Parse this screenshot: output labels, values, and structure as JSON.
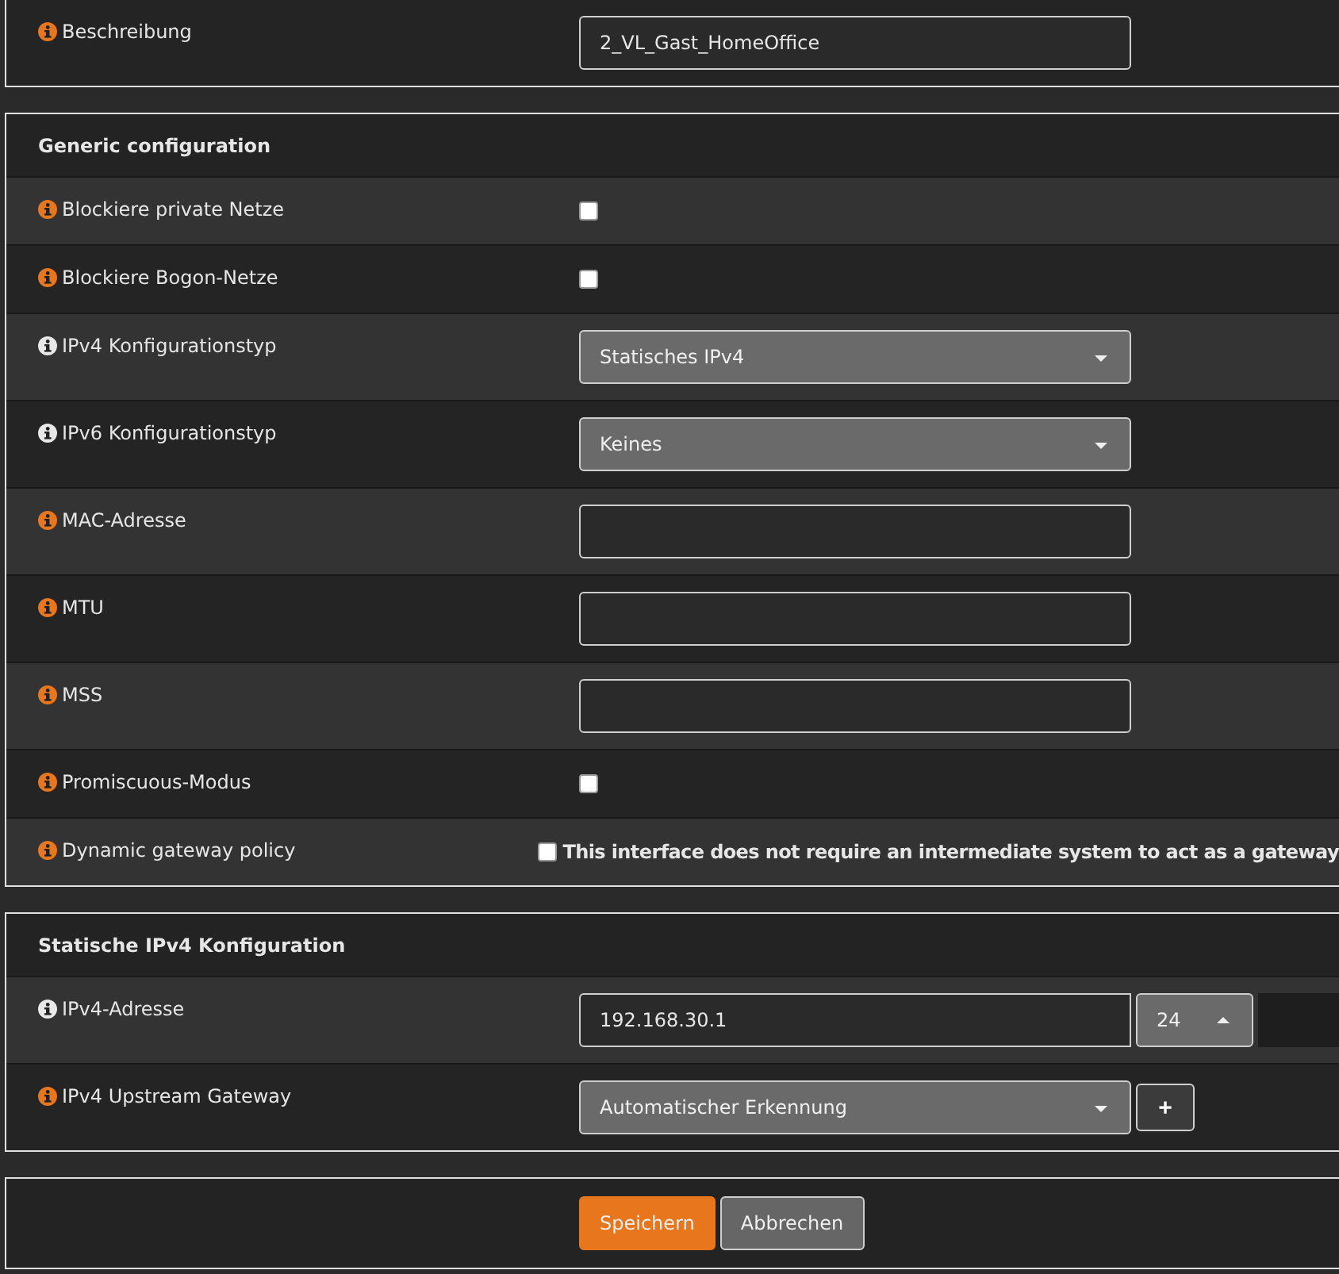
{
  "panels": [
    {
      "rows": [
        {
          "kind": "text",
          "label": "Beschreibung",
          "color": "#e8761c",
          "value": "2_VL_Gast_HomeOffice"
        }
      ]
    },
    {
      "title": "Generic configuration",
      "rows": [
        {
          "kind": "checkbox",
          "label": "Blockiere private Netze",
          "color": "#e8761c",
          "checked": false
        },
        {
          "kind": "checkbox",
          "label": "Blockiere Bogon-Netze",
          "color": "#e8761c",
          "checked": false
        },
        {
          "kind": "select",
          "label": "IPv4 Konfigurationstyp",
          "color": "#e8e8e8",
          "value": "Statisches IPv4"
        },
        {
          "kind": "select",
          "label": "IPv6 Konfigurationstyp",
          "color": "#e8e8e8",
          "value": "Keines"
        },
        {
          "kind": "text",
          "label": "MAC-Adresse",
          "color": "#e8761c",
          "value": ""
        },
        {
          "kind": "text",
          "label": "MTU",
          "color": "#e8761c",
          "value": ""
        },
        {
          "kind": "text",
          "label": "MSS",
          "color": "#e8761c",
          "value": ""
        },
        {
          "kind": "checkbox",
          "label": "Promiscuous-Modus",
          "color": "#e8761c",
          "checked": false
        },
        {
          "kind": "checkbox",
          "label": "Dynamic gateway policy",
          "color": "#e8761c",
          "checked": false,
          "text": "This interface does not require an intermediate system to act as a gateway"
        }
      ]
    },
    {
      "title": "Statische IPv4 Konfiguration",
      "rows": [
        {
          "kind": "cidr",
          "label": "IPv4-Adresse",
          "color": "#e8e8e8",
          "value": "192.168.30.1",
          "prefix": "24"
        },
        {
          "kind": "select_add",
          "label": "IPv4 Upstream Gateway",
          "color": "#e8761c",
          "value": "Automatischer Erkennung",
          "button": "+"
        }
      ]
    }
  ],
  "buttons": [
    {
      "label": "Speichern",
      "primary": true
    },
    {
      "label": "Abbrechen",
      "primary": false
    }
  ]
}
